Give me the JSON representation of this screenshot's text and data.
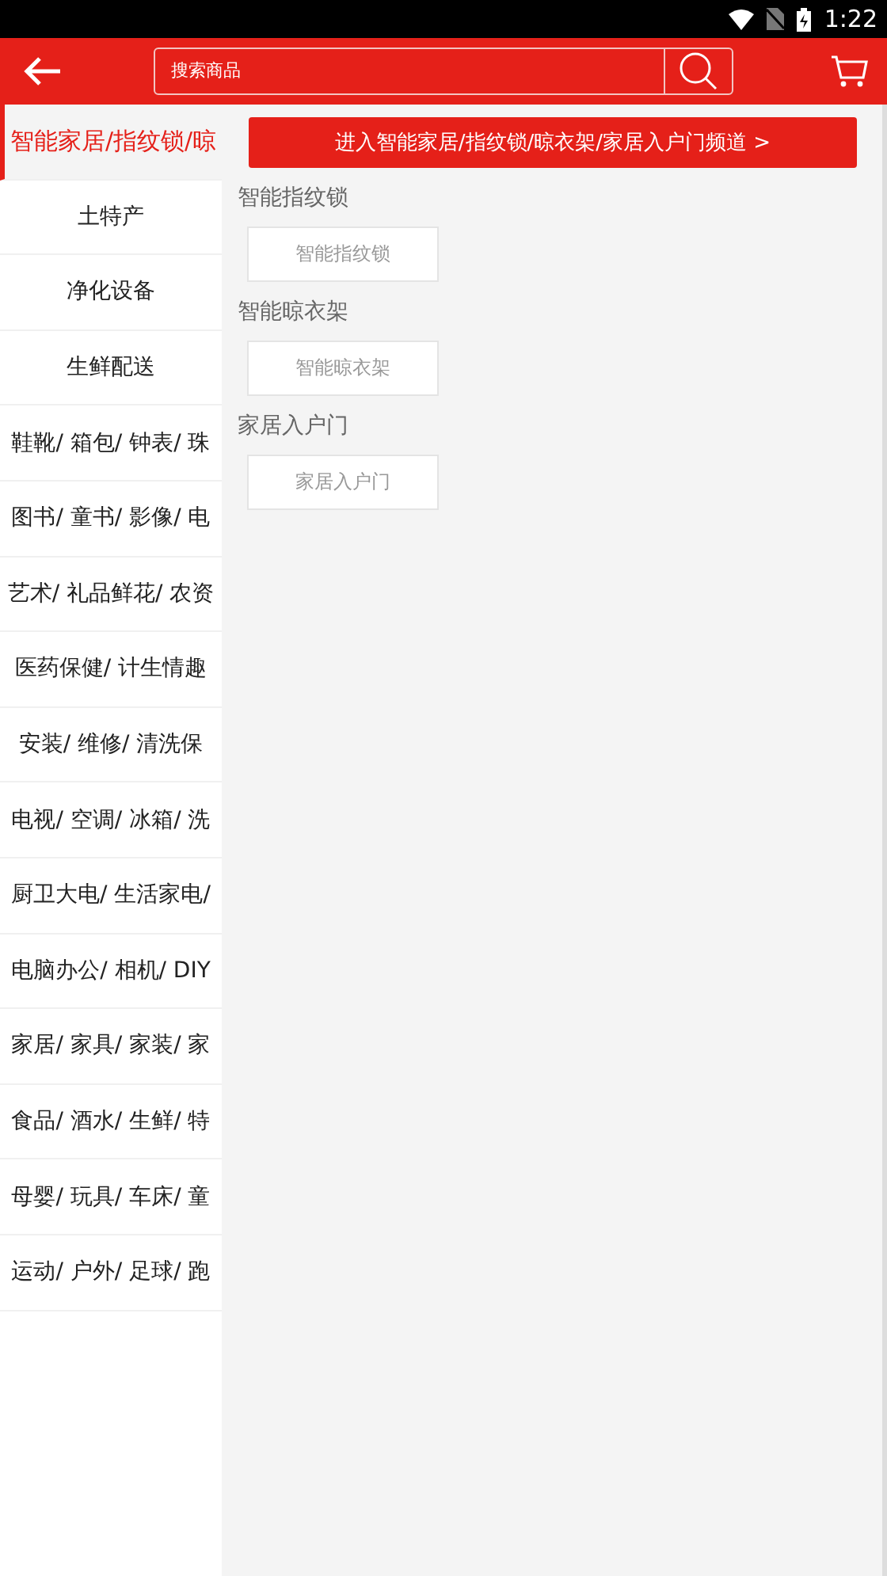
{
  "status_bar": {
    "time": "1:22"
  },
  "header": {
    "search": {
      "placeholder": "搜索商品"
    }
  },
  "sidebar": {
    "items": [
      {
        "label": "智能家居/指纹锁/晾",
        "selected": true
      },
      {
        "label": "土特产",
        "selected": false
      },
      {
        "label": "净化设备",
        "selected": false
      },
      {
        "label": "生鲜配送",
        "selected": false
      },
      {
        "label": "鞋靴/ 箱包/ 钟表/ 珠",
        "selected": false
      },
      {
        "label": "图书/ 童书/ 影像/ 电",
        "selected": false
      },
      {
        "label": "艺术/ 礼品鲜花/ 农资",
        "selected": false
      },
      {
        "label": "医药保健/ 计生情趣",
        "selected": false
      },
      {
        "label": "安装/ 维修/ 清洗保",
        "selected": false
      },
      {
        "label": "电视/ 空调/ 冰箱/ 洗",
        "selected": false
      },
      {
        "label": "厨卫大电/ 生活家电/",
        "selected": false
      },
      {
        "label": "电脑办公/ 相机/ DIY",
        "selected": false
      },
      {
        "label": "家居/ 家具/ 家装/ 家",
        "selected": false
      },
      {
        "label": "食品/ 酒水/ 生鲜/ 特",
        "selected": false
      },
      {
        "label": "母婴/ 玩具/ 车床/ 童",
        "selected": false
      },
      {
        "label": "运动/ 户外/ 足球/ 跑",
        "selected": false
      }
    ]
  },
  "content": {
    "channel_button": "进入智能家居/指纹锁/晾衣架/家居入户门频道 >",
    "sections": [
      {
        "title": "智能指纹锁",
        "items": [
          "智能指纹锁"
        ]
      },
      {
        "title": "智能晾衣架",
        "items": [
          "智能晾衣架"
        ]
      },
      {
        "title": "家居入户门",
        "items": [
          "家居入户门"
        ]
      }
    ]
  }
}
